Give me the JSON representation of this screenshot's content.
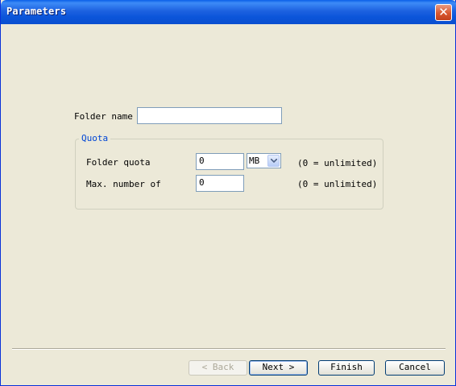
{
  "window": {
    "title": "Parameters",
    "close_glyph": "✕"
  },
  "form": {
    "folder_name_label": "Folder name",
    "folder_name_value": "",
    "quota_group_title": "Quota",
    "folder_quota_label": "Folder quota",
    "folder_quota_value": "0",
    "folder_quota_unit": "MB",
    "folder_quota_note": "(0 = unlimited)",
    "max_number_label": "Max. number of",
    "max_number_value": "0",
    "max_number_note": "(0 = unlimited)"
  },
  "buttons": {
    "back": "< Back",
    "next": "Next >",
    "finish": "Finish",
    "cancel": "Cancel"
  },
  "icons": {
    "close": "close-icon",
    "dropdown": "chevron-down-icon"
  },
  "colors": {
    "titlebar": "#0A5FE8",
    "window_bg": "#ECE9D8",
    "group_title": "#0046D5"
  }
}
